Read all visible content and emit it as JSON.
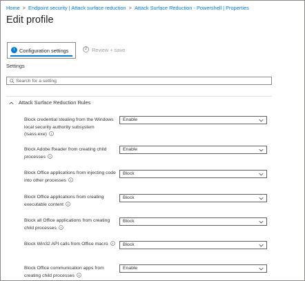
{
  "breadcrumb": {
    "items": [
      "Home",
      "Endpoint security | Attack surface reduction",
      "Attack Surface Reduction - Powershell | Properties"
    ],
    "separator": ">"
  },
  "page": {
    "title": "Edit profile"
  },
  "steps": [
    {
      "number": "1",
      "label": "Configuration settings",
      "active": true
    },
    {
      "number": "2",
      "label": "Review + save",
      "active": false
    }
  ],
  "settings_heading": "Settings",
  "search": {
    "placeholder": "Search for a setting",
    "value": ""
  },
  "section": {
    "title": "Attack Surface Reduction Rules",
    "expanded": true
  },
  "rules": [
    {
      "label": "Block credential stealing from the Windows local security authority subsystem (lsass.exe)",
      "value": "Enable"
    },
    {
      "label": "Block Adobe Reader from creating child processes",
      "value": "Enable"
    },
    {
      "label": "Block Office applications from injecting code into other processes",
      "value": "Block"
    },
    {
      "label": "Block Office applications from creating executable content",
      "value": "Block"
    },
    {
      "label": "Block all Office applications from creating child processes",
      "value": "Block"
    },
    {
      "label": "Block Win32 API calls from Office macro",
      "value": "Block"
    },
    {
      "label": "Block Office communication apps from creating child processes",
      "value": "Enable"
    }
  ],
  "colors": {
    "accent": "#0078d4",
    "border": "#8a8886",
    "text": "#323130"
  },
  "icons": {
    "info": "info-icon",
    "dropdown": "chevron-down-icon",
    "section": "chevron-up-icon",
    "search": "search-icon"
  }
}
